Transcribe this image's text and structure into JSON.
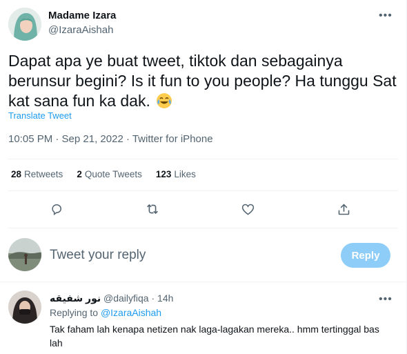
{
  "tweet": {
    "author_name": "Madame Izara",
    "author_handle": "@IzaraAishah",
    "text": "Dapat apa ye buat tweet, tiktok dan sebagainya berunsur begini? Is it fun to you people? Ha tunggu Sat kat sana fun ka dak.",
    "emoji": "laughing-tears-emoji",
    "translate_label": "Translate Tweet",
    "timestamp": "10:05 PM · Sep 21, 2022 · Twitter for iPhone"
  },
  "stats": {
    "retweets_count": "28",
    "retweets_label": "Retweets",
    "quotes_count": "2",
    "quotes_label": "Quote Tweets",
    "likes_count": "123",
    "likes_label": "Likes"
  },
  "actions": [
    "reply-icon",
    "retweet-icon",
    "like-icon",
    "share-icon"
  ],
  "reply_composer": {
    "placeholder": "Tweet your reply",
    "button_label": "Reply"
  },
  "reply": {
    "author_name": "نور شفيقه",
    "author_handle": "@dailyfiqa",
    "separator": "·",
    "time": "14h",
    "replying_prefix": "Replying to",
    "replying_to": "@IzaraAishah",
    "text": "Tak faham lah kenapa netizen nak laga-lagakan mereka.. hmm tertinggal bas lah"
  },
  "colors": {
    "accent": "#1d9bf0",
    "muted": "#536471",
    "reply_button_disabled": "#8ecdf8"
  }
}
